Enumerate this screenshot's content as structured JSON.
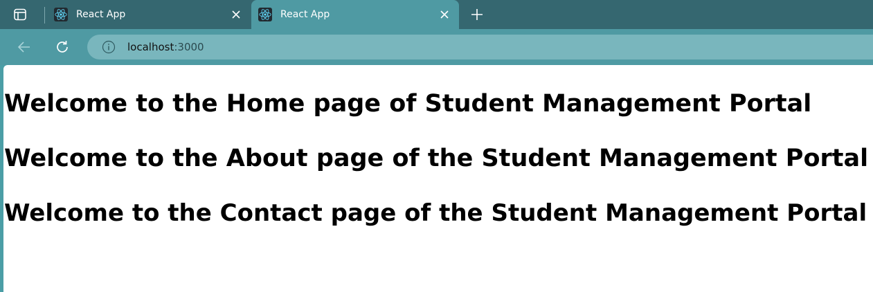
{
  "browser": {
    "tabs": [
      {
        "title": "React App",
        "active": false
      },
      {
        "title": "React App",
        "active": true
      }
    ],
    "address_bar": {
      "host": "localhost",
      "port": ":3000"
    },
    "icons": {
      "tab_actions": "tab-actions-icon",
      "favicon": "react-logo-icon",
      "close": "close-icon",
      "new_tab": "plus-icon",
      "back": "back-arrow-icon",
      "reload": "reload-icon",
      "info": "info-icon"
    },
    "colors": {
      "tabstrip": "#356770",
      "toolbar": "#4f9aa3",
      "omnibox": "#79b6bd",
      "react_logo": "#61dafb"
    }
  },
  "page": {
    "headings": [
      "Welcome to the Home page of Student Management Portal",
      "Welcome to the About page of the Student Management Portal",
      "Welcome to the Contact page of the Student Management Portal"
    ]
  }
}
